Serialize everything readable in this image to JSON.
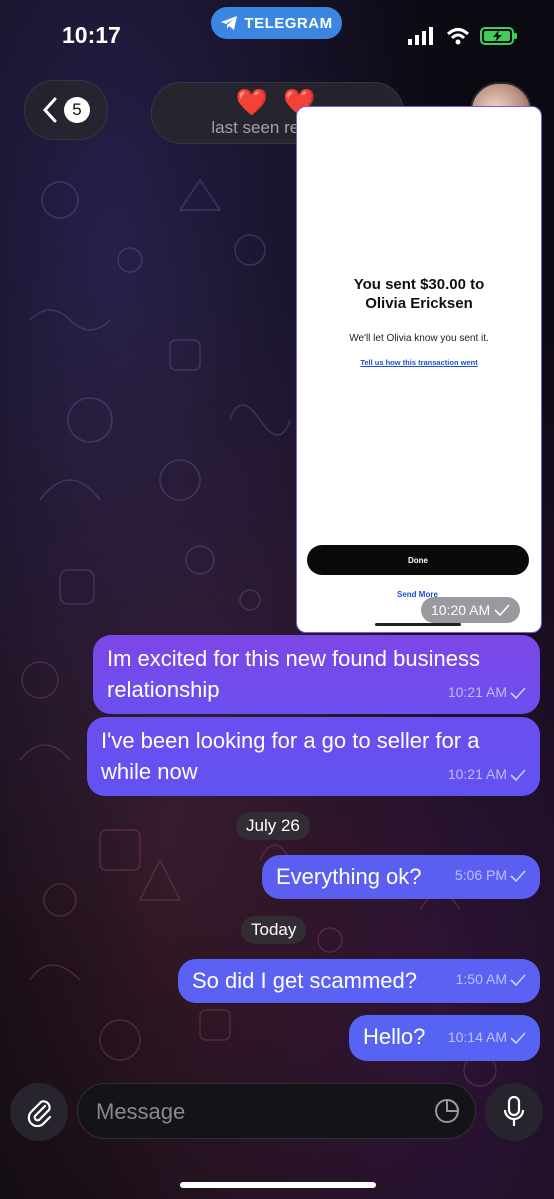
{
  "status_bar": {
    "time": "10:17",
    "app_badge": "TELEGRAM"
  },
  "header": {
    "back_count": "5",
    "title": "❤️ ❤️",
    "subtitle": "last seen recently"
  },
  "image_message": {
    "title_line1": "You sent $30.00 to",
    "title_line2": "Olivia Ericksen",
    "body": "We'll let Olivia know you sent it.",
    "link": "Tell us how this transaction went",
    "done_label": "Done",
    "send_more_label": "Send More",
    "time": "10:20 AM"
  },
  "messages": [
    {
      "text": "Im excited for this new found business relationship",
      "time": "10:21 AM"
    },
    {
      "text": "I've been looking for a go to seller for a while now",
      "time": "10:21 AM"
    },
    {
      "text": "Everything ok?",
      "time": "5:06 PM"
    },
    {
      "text": "So did I get scammed?",
      "time": "1:50 AM"
    },
    {
      "text": "Hello?",
      "time": "10:14 AM"
    }
  ],
  "dates": {
    "d1": "July 26",
    "d2": "Today"
  },
  "composer": {
    "placeholder": "Message"
  },
  "colors": {
    "bubble": "#6b4ff0",
    "accent": "#3b86e0"
  }
}
